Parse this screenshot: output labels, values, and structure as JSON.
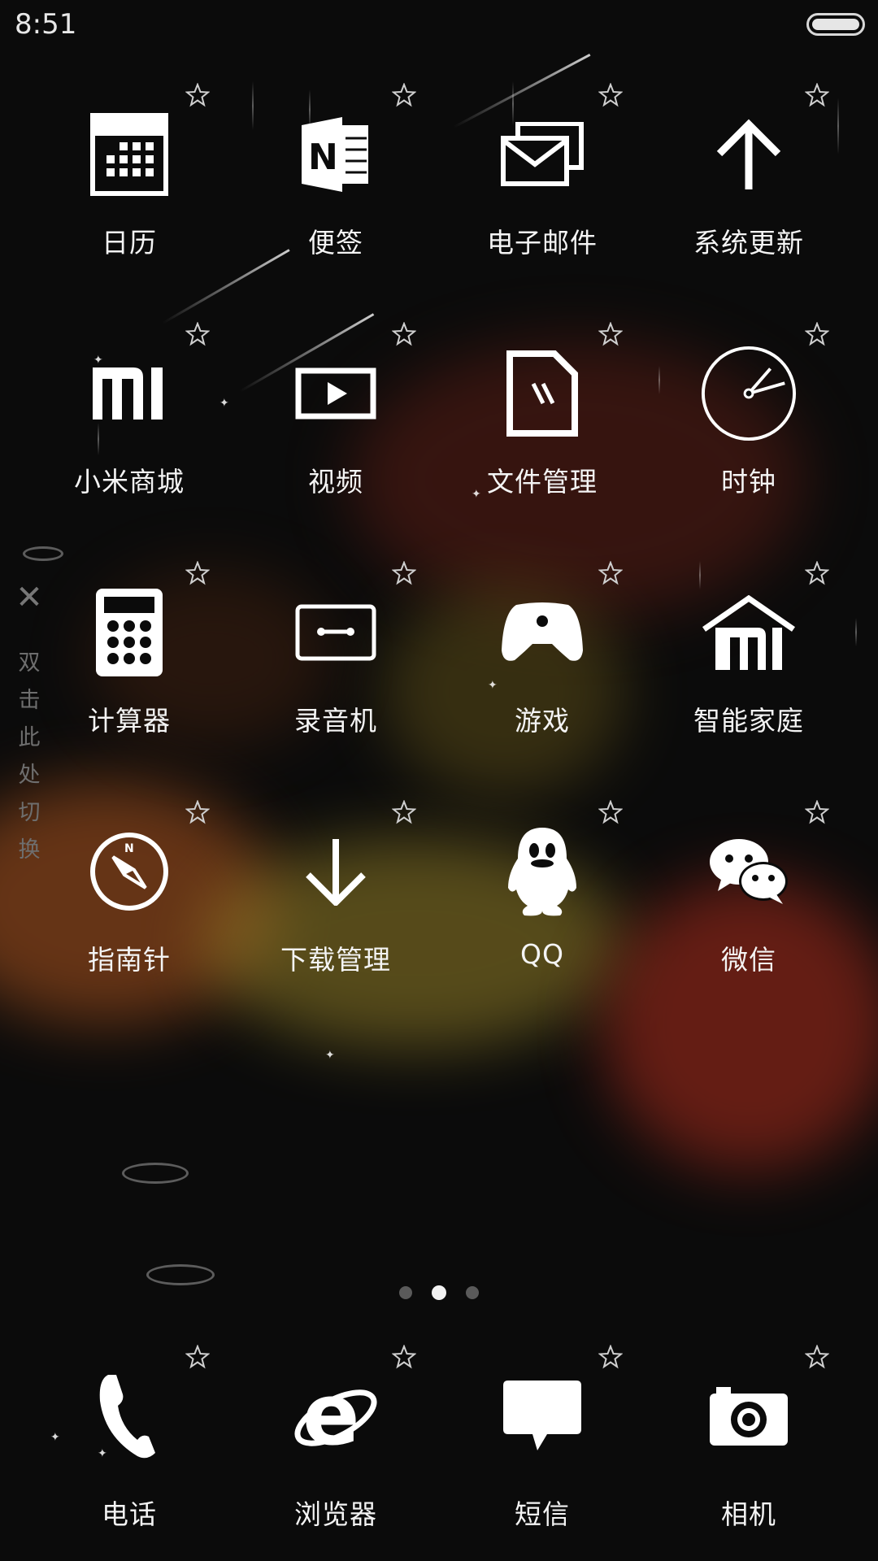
{
  "status_bar": {
    "time": "8:51"
  },
  "side_hint": {
    "text": [
      "双",
      "击",
      "此",
      "处",
      "切",
      "换"
    ]
  },
  "apps": [
    {
      "label": "日历",
      "icon": "calendar-icon"
    },
    {
      "label": "便签",
      "icon": "onenote-icon"
    },
    {
      "label": "电子邮件",
      "icon": "email-icon"
    },
    {
      "label": "系统更新",
      "icon": "arrow-up-icon"
    },
    {
      "label": "小米商城",
      "icon": "mi-logo-icon"
    },
    {
      "label": "视频",
      "icon": "video-play-icon"
    },
    {
      "label": "文件管理",
      "icon": "file-icon"
    },
    {
      "label": "时钟",
      "icon": "clock-icon"
    },
    {
      "label": "计算器",
      "icon": "calculator-icon"
    },
    {
      "label": "录音机",
      "icon": "cassette-icon"
    },
    {
      "label": "游戏",
      "icon": "gamepad-icon"
    },
    {
      "label": "智能家庭",
      "icon": "smart-home-icon"
    },
    {
      "label": "指南针",
      "icon": "compass-icon"
    },
    {
      "label": "下载管理",
      "icon": "download-arrow-icon"
    },
    {
      "label": "QQ",
      "icon": "qq-penguin-icon"
    },
    {
      "label": "微信",
      "icon": "wechat-icon"
    }
  ],
  "pager": {
    "count": 3,
    "active_index": 1
  },
  "dock": [
    {
      "label": "电话",
      "icon": "phone-icon"
    },
    {
      "label": "浏览器",
      "icon": "browser-e-icon"
    },
    {
      "label": "短信",
      "icon": "message-icon"
    },
    {
      "label": "相机",
      "icon": "camera-icon"
    }
  ]
}
